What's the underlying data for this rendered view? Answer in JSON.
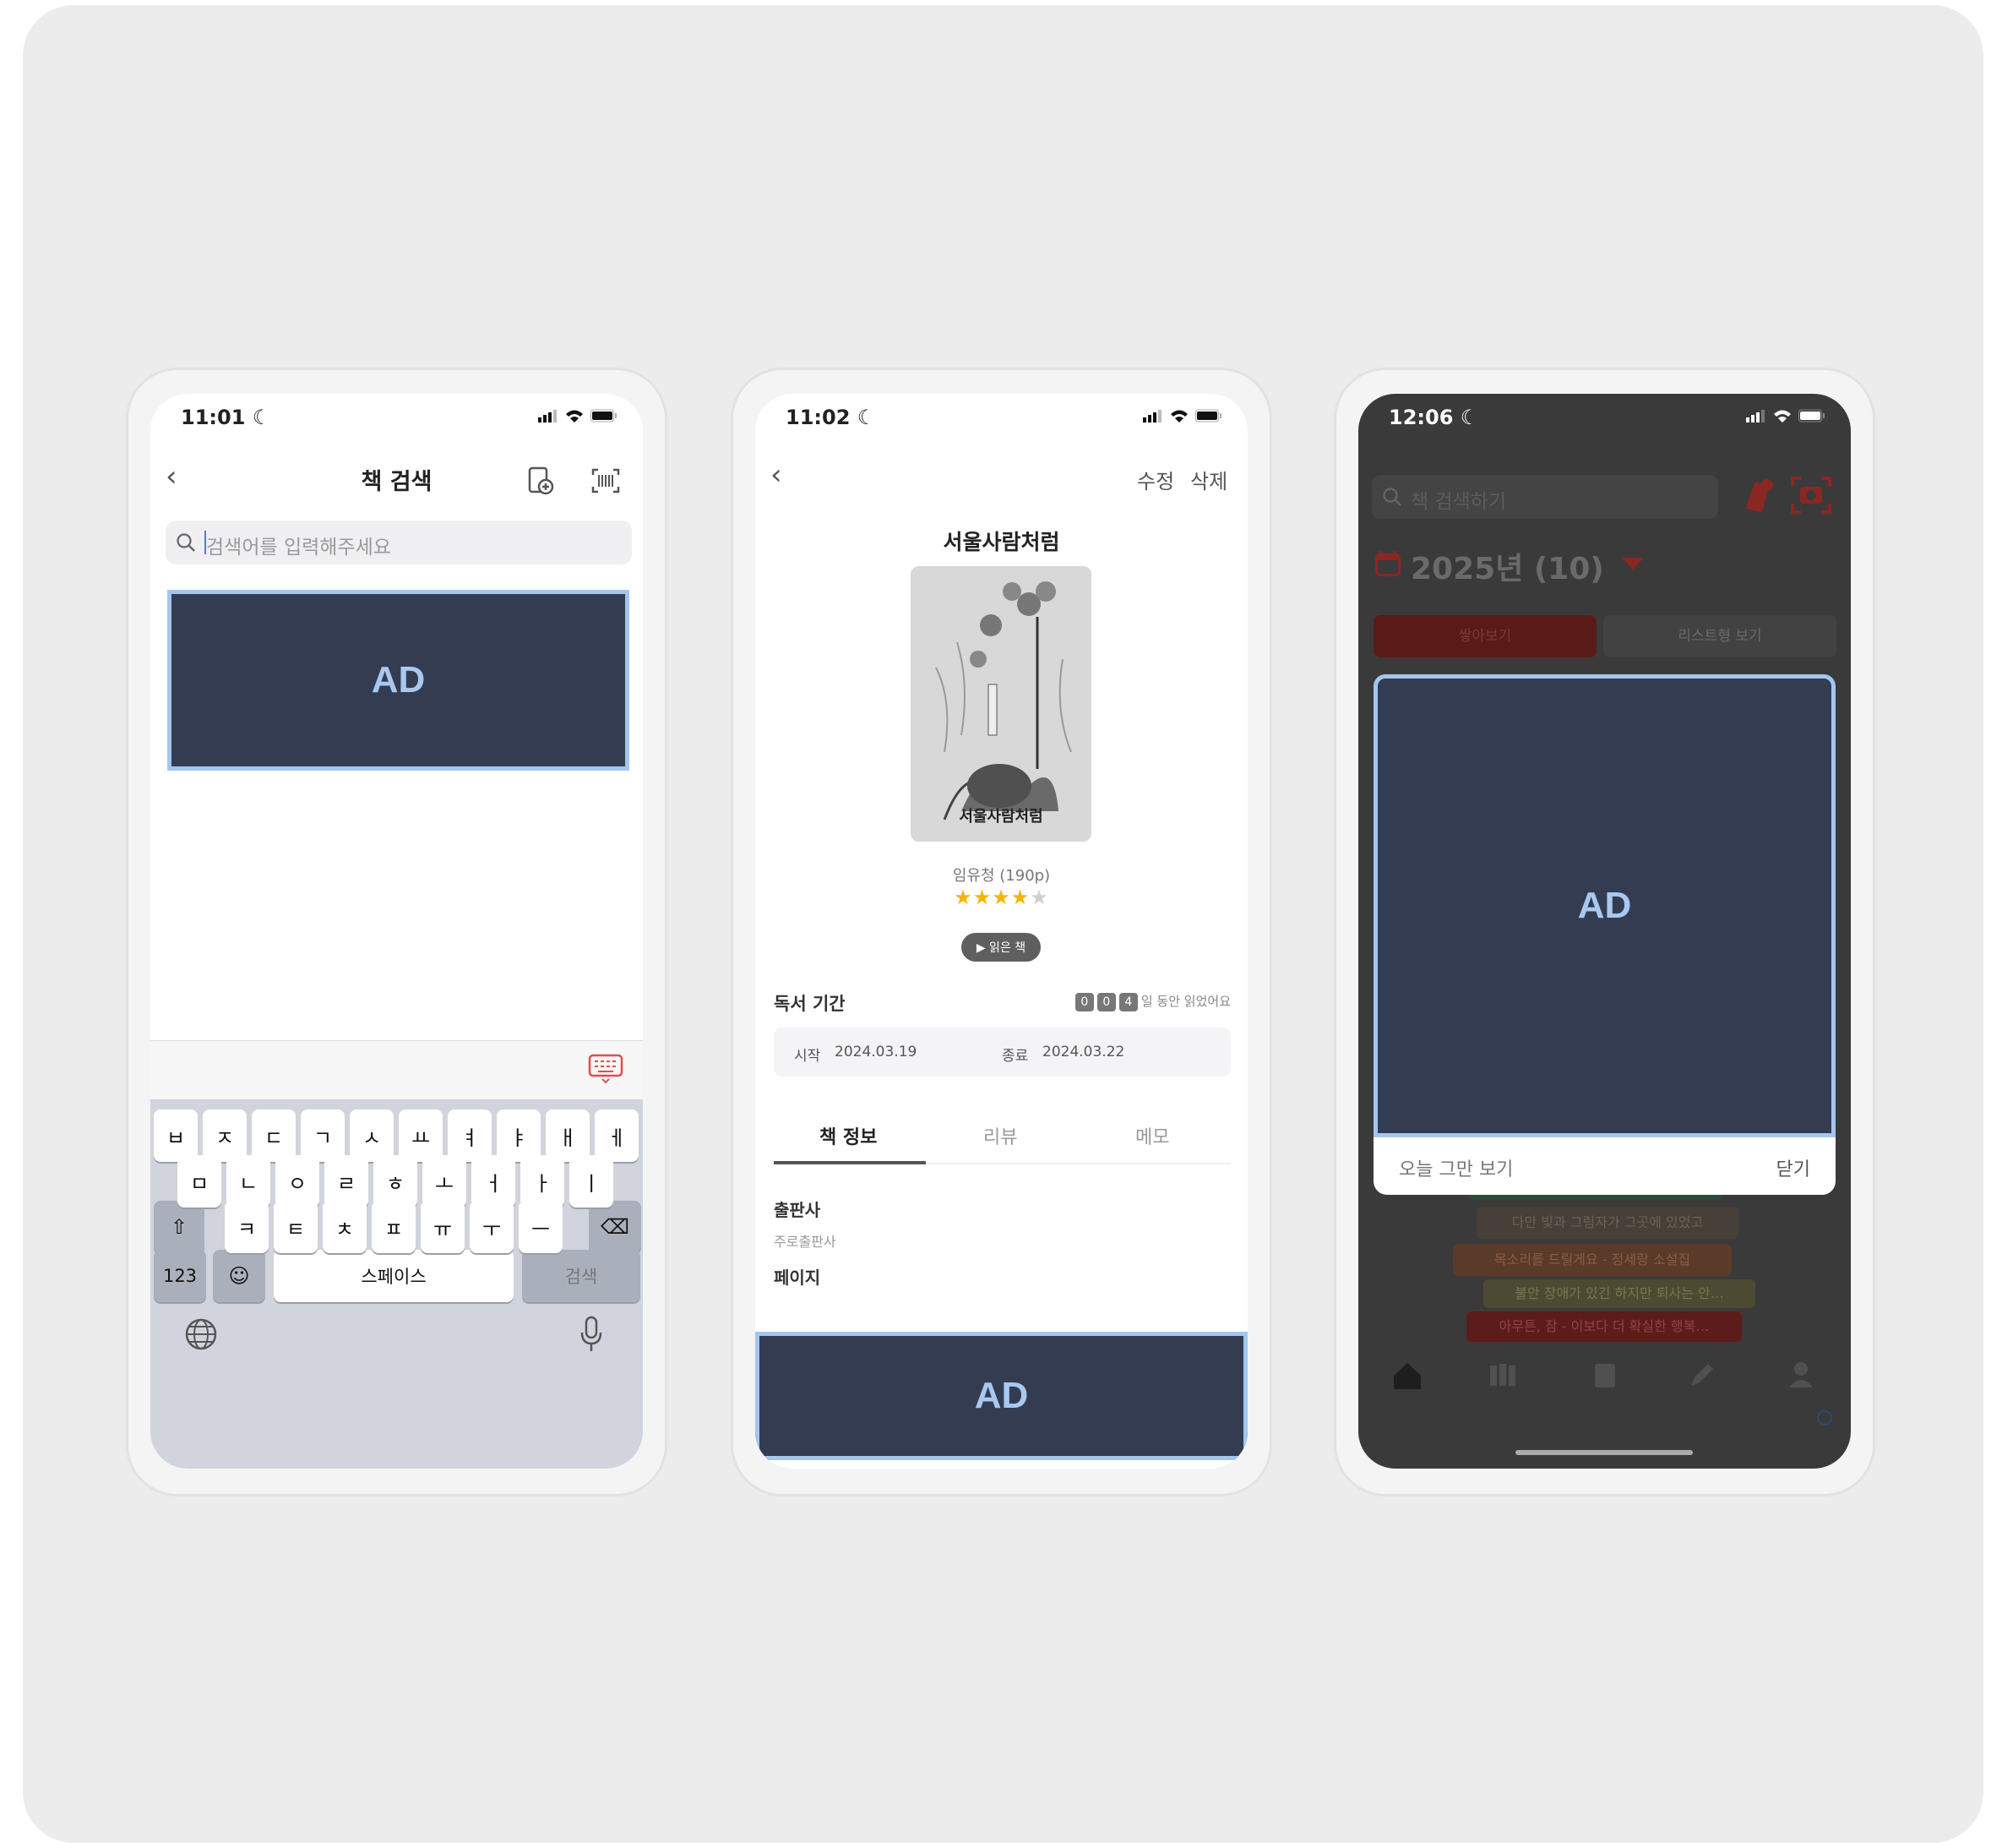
{
  "colors": {
    "ad_bg": "#343c52",
    "ad_border": "#a3c6ef",
    "accent_red": "#c0302b",
    "star": "#f4b400"
  },
  "ad_label": "AD",
  "screen1": {
    "time": "11:01",
    "title": "책 검색",
    "search_placeholder": "검색어를 입력해주세요",
    "keyboard": {
      "row1": [
        "ㅂ",
        "ㅈ",
        "ㄷ",
        "ㄱ",
        "ㅅ",
        "ㅛ",
        "ㅕ",
        "ㅑ",
        "ㅐ",
        "ㅔ"
      ],
      "row2": [
        "ㅁ",
        "ㄴ",
        "ㅇ",
        "ㄹ",
        "ㅎ",
        "ㅗ",
        "ㅓ",
        "ㅏ",
        "ㅣ"
      ],
      "row3": [
        "ㅋ",
        "ㅌ",
        "ㅊ",
        "ㅍ",
        "ㅠ",
        "ㅜ",
        "ㅡ"
      ],
      "num_key": "123",
      "space_key": "스페이스",
      "search_key": "검색"
    }
  },
  "screen2": {
    "time": "11:02",
    "edit": "수정",
    "delete": "삭제",
    "book_title": "서울사람처럼",
    "cover_text": "서울사람처럼",
    "author": "임유청 (190p)",
    "rating": 4,
    "rating_max": 5,
    "badge": "▶ 읽은 책",
    "period_label": "독서 기간",
    "days_digits": [
      "0",
      "0",
      "4"
    ],
    "days_suffix": "일 동안 읽었어요",
    "start_label": "시작",
    "start_date": "2024.03.19",
    "end_label": "종료",
    "end_date": "2024.03.22",
    "tabs": [
      "책 정보",
      "리뷰",
      "메모"
    ],
    "publisher_label": "출판사",
    "publisher_value": "주로출판사",
    "page_label": "페이지"
  },
  "screen3": {
    "time": "12:06",
    "search_placeholder": "책 검색하기",
    "month": "2025년 (10)",
    "view_tabs": [
      "쌓아보기",
      "리스트형 보기"
    ],
    "list_items": [
      "다만 빛과 그림자가 그곳에 있었고",
      "목소리를 드릴게요 - 정세랑 소설집",
      "불안 장애가 있긴 하지만 퇴사는 안…",
      "아무튼, 잠 - 이보다 더 확실한 행복…"
    ],
    "dont_show": "오늘 그만 보기",
    "close": "닫기"
  }
}
